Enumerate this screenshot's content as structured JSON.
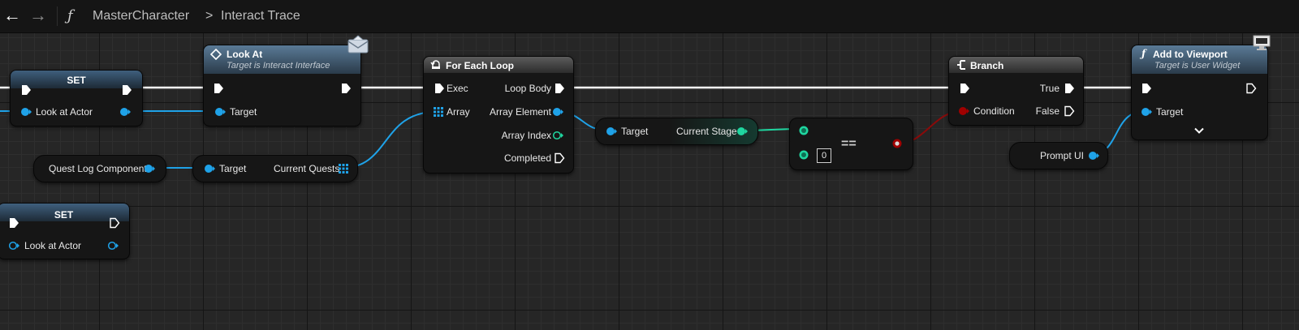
{
  "breadcrumb": {
    "function_icon": "ƒ",
    "parent": "MasterCharacter",
    "separator": ">",
    "current": "Interact Trace"
  },
  "colors": {
    "exec": "#ffffff",
    "object": "#1fa2e8",
    "integer": "#1fd6a0",
    "boolean": "#a00000",
    "header_blue": "#3f5f7d",
    "header_gray": "#4a4a4a"
  },
  "nodes": {
    "set_top": {
      "title": "SET",
      "var_label": "Look at Actor"
    },
    "set_bottom": {
      "title": "SET",
      "var_label": "Look at Actor"
    },
    "look_at": {
      "title": "Look At",
      "subtitle": "Target is Interact Interface",
      "target_label": "Target",
      "badge_icon": "envelope-icon"
    },
    "quest_log": {
      "label": "Quest Log Component"
    },
    "get_quests": {
      "target_label": "Target",
      "output_label": "Current Quests"
    },
    "for_each": {
      "title": "For Each Loop",
      "exec_label": "Exec",
      "array_label": "Array",
      "loop_body_label": "Loop Body",
      "element_label": "Array Element",
      "index_label": "Array Index",
      "completed_label": "Completed"
    },
    "get_stage": {
      "target_label": "Target",
      "output_label": "Current Stage"
    },
    "equals": {
      "operator": "==",
      "default_value": "0"
    },
    "branch": {
      "title": "Branch",
      "condition_label": "Condition",
      "true_label": "True",
      "false_label": "False"
    },
    "prompt_ui": {
      "label": "Prompt UI"
    },
    "add_viewport": {
      "title": "Add to Viewport",
      "subtitle": "Target is User Widget",
      "target_label": "Target",
      "expand_icon": "chevron-down-icon",
      "badge_icon": "monitor-icon"
    }
  }
}
